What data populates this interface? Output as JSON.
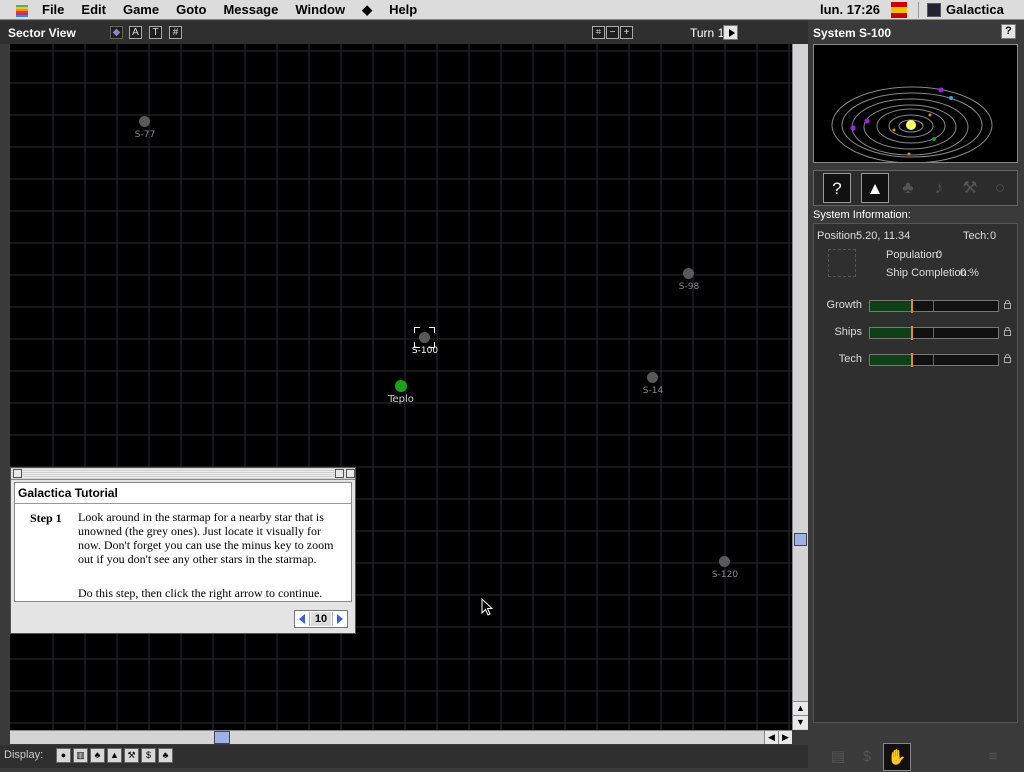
{
  "menubar": {
    "items": [
      "File",
      "Edit",
      "Game",
      "Goto",
      "Message",
      "Window",
      "◆",
      "Help"
    ],
    "clock": "lun. 17:26",
    "app_name": "Galactica"
  },
  "sector": {
    "title": "Sector View",
    "turn_label": "Turn 1",
    "stars": [
      {
        "name": "S-77",
        "owned": false,
        "selected": false
      },
      {
        "name": "S-98",
        "owned": false,
        "selected": false
      },
      {
        "name": "S-100",
        "owned": false,
        "selected": true
      },
      {
        "name": "Teplo",
        "owned": true,
        "selected": false
      },
      {
        "name": "S-14",
        "owned": false,
        "selected": false
      },
      {
        "name": "S-120",
        "owned": false,
        "selected": false
      }
    ]
  },
  "display_bar": {
    "label": "Display:"
  },
  "system": {
    "title": "System S-100",
    "info_label": "System Information:",
    "position_label": "Position:",
    "position_value": "5.20, 11.34",
    "tech_label": "Tech:",
    "tech_value": "0",
    "population_label": "Population:",
    "population_value": "0",
    "ship_completion_label": "Ship Completion:",
    "ship_completion_value": "0 %",
    "sliders": [
      {
        "label": "Growth",
        "fill": 0.33
      },
      {
        "label": "Ships",
        "fill": 0.33
      },
      {
        "label": "Tech",
        "fill": 0.33
      }
    ]
  },
  "tutorial": {
    "title": "Galactica Tutorial",
    "step_label": "Step 1",
    "step_text": "Look around in the starmap for a nearby star that is unowned (the grey ones). Just locate it visually for now. Don't forget you can use the minus key to zoom out if you don't see any other stars in the starmap.",
    "note": "Do this step, then click the right arrow to continue.",
    "page": "10"
  },
  "colors": {
    "owned_star": "#1aa31a",
    "unowned_star": "#595959",
    "grid": "#2a2a3a",
    "slider_marker": "#e88a1e"
  }
}
